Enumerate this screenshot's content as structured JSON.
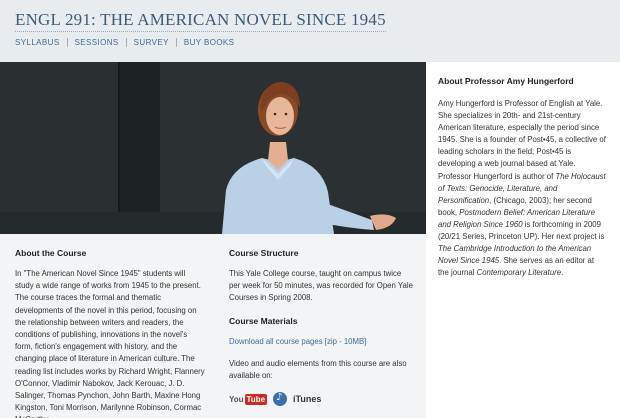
{
  "header": {
    "title": "ENGL 291: THE AMERICAN NOVEL SINCE 1945",
    "nav": [
      "SYLLABUS",
      "SESSIONS",
      "SURVEY",
      "BUY BOOKS"
    ]
  },
  "about_course": {
    "heading": "About the Course",
    "body": "In \"The American Novel Since 1945\" students will study a wide range of works from 1945 to the present. The course traces the formal and thematic developments of the novel in this period, focusing on the relationship between writers and readers, the conditions of publishing, innovations in the novel's form, fiction's engagement with history, and the changing place of literature in American culture. The reading list includes works by Richard Wright, Flannery O'Connor, Vladimir Nabokov, Jack Kerouac, J. D. Salinger, Thomas Pynchon, John Barth, Maxine Hong Kingston, Toni Morrison, Marilynne Robinson, Cormac McCarthy,"
  },
  "course_structure": {
    "heading": "Course Structure",
    "body": "This Yale College course, taught on campus twice per week for 50 minutes, was recorded for Open Yale Courses in Spring 2008."
  },
  "course_materials": {
    "heading": "Course Materials",
    "download_link": "Download all course pages [zip - 10MB]",
    "av_text": "Video and audio elements from this course are also available on:",
    "youtube_you": "You",
    "youtube_tube": "Tube",
    "itunes": "iTunes"
  },
  "professor": {
    "heading": "About Professor Amy Hungerford",
    "t1": "Amy Hungerford is Professor of English at Yale. She specializes in 20th- and 21st-century American literature, especially the period since 1945. She is a founder of Post•45, a collective of leading scholars in the field; Post•45 is developing a web journal based at Yale. Professor Hungerford is author of ",
    "book1": "The Holocaust of Texts: Genocide, Literature, and Personification",
    "t2": ", (Chicago, 2003); her second book, ",
    "book2": "Postmodern Belief: American Literature and Religion Since 1960",
    "t3": " is forthcoming in 2009 (20/21 Series, Princeton UP). Her next project is ",
    "book3": "The Cambridge Introduction to the American Novel Since 1945",
    "t4": ". She serves as an editor at the journal ",
    "journal": "Contemporary Literature",
    "t5": "."
  },
  "colors": {
    "title": "#3d5a7a",
    "link": "#3d6b99",
    "header_bg": "#e9ecef",
    "youtube_red": "#cc2b1f"
  }
}
